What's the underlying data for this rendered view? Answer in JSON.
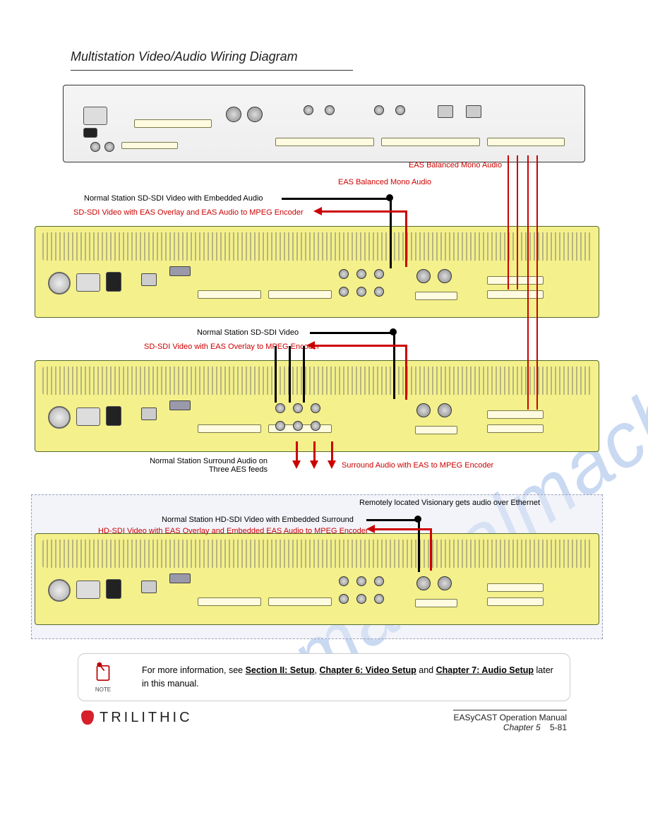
{
  "heading": "Multistation Video/Audio Wiring Diagram",
  "annotations": {
    "eas_mono_top": "EAS Balanced Mono Audio",
    "eas_mono_bot": "EAS Balanced Mono Audio",
    "norm_sd_emb": "Normal Station SD-SDI Video with Embedded Audio",
    "sd_overlay_audio": "SD-SDI Video with EAS Overlay and EAS Audio to MPEG Encoder",
    "norm_sd": "Normal Station SD-SDI Video",
    "sd_overlay": "SD-SDI Video with EAS Overlay to MPEG Encoder",
    "norm_surround": "Normal Station Surround Audio on Three AES feeds",
    "surround_eas": "Surround Audio with EAS to MPEG Encoder",
    "remote_title": "Remotely located Visionary gets audio over Ethernet",
    "norm_hd": "Normal Station HD-SDI Video with Embedded Surround",
    "hd_overlay": "HD-SDI Video with EAS Overlay and Embedded EAS Audio to MPEG Encoder"
  },
  "note": {
    "label": "NOTE",
    "text_parts": [
      "For more information, see ",
      "Section II: Setup",
      ", ",
      "Chapter 6: Video Setup",
      " and ",
      "Chapter 7: Audio Setup",
      " later in this manual."
    ]
  },
  "footer": {
    "brand": "TRILITHIC",
    "manual": "EASyCAST Operation Manual",
    "chapter_label": "Chapter 5",
    "page": "5-81"
  },
  "watermark": "manualmachine.com"
}
